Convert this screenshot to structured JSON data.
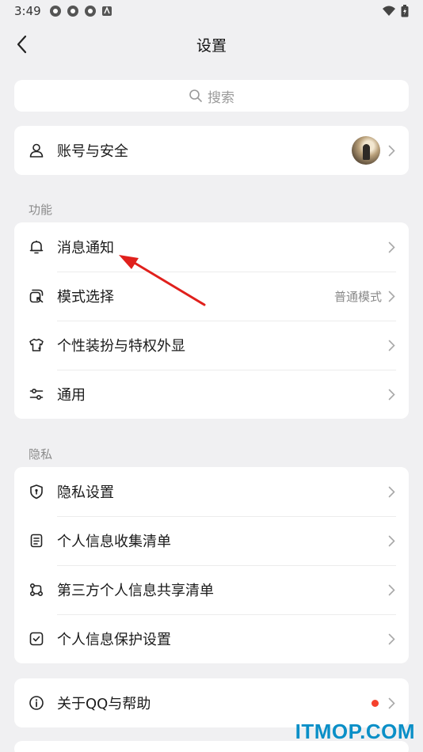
{
  "status_bar": {
    "time": "3:49"
  },
  "nav": {
    "title": "设置"
  },
  "search": {
    "placeholder": "搜索"
  },
  "account": {
    "label": "账号与安全"
  },
  "sections": {
    "function_title": "功能",
    "privacy_title": "隐私"
  },
  "function_items": [
    {
      "label": "消息通知"
    },
    {
      "label": "模式选择",
      "value": "普通模式"
    },
    {
      "label": "个性装扮与特权外显"
    },
    {
      "label": "通用"
    }
  ],
  "privacy_items": [
    {
      "label": "隐私设置"
    },
    {
      "label": "个人信息收集清单"
    },
    {
      "label": "第三方个人信息共享清单"
    },
    {
      "label": "个人信息保护设置"
    }
  ],
  "about": {
    "label": "关于QQ与帮助"
  },
  "watermark": "ITMOP.COM",
  "colors": {
    "accent_red": "#f5412d",
    "watermark": "#0a8fc7",
    "annotation_arrow": "#e0201c"
  }
}
